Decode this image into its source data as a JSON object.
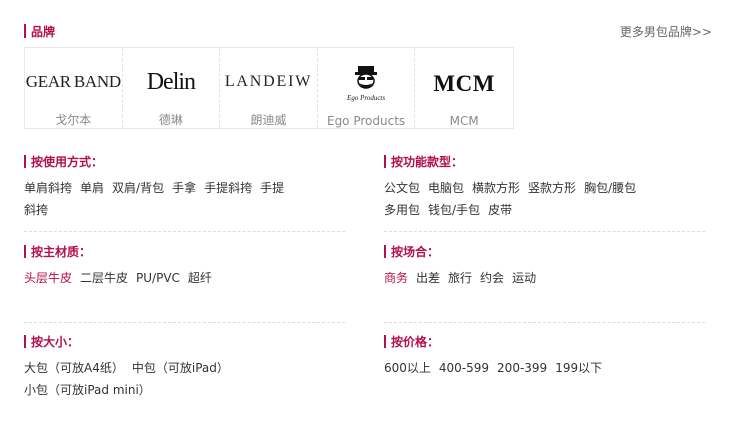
{
  "brands": {
    "title": "品牌",
    "more_link": "更多男包品牌>>",
    "items": [
      {
        "name": "戈尔本",
        "logo_text_1": "GEAR",
        "logo_text_2": "BAND",
        "icon": "gear-band-logo"
      },
      {
        "name": "德琳",
        "logo_text": "Delin",
        "icon": "delin-logo"
      },
      {
        "name": "朗迪威",
        "logo_text": "LANDEIW",
        "icon": "landeiw-logo"
      },
      {
        "name": "Ego Products",
        "logo_text": "Ego Products",
        "icon": "ego-products-logo"
      },
      {
        "name": "MCM",
        "logo_text": "MCM",
        "icon": "mcm-logo"
      }
    ]
  },
  "filters": {
    "usage": {
      "title": "按使用方式：",
      "options": [
        "单肩斜挎",
        "单肩",
        "双肩/背包",
        "手拿",
        "手提斜挎",
        "手提",
        "斜挎"
      ]
    },
    "function": {
      "title": "按功能款型：",
      "options": [
        "公文包",
        "电脑包",
        "横款方形",
        "竖款方形",
        "胸包/腰包",
        "多用包",
        "钱包/手包",
        "皮带"
      ]
    },
    "material": {
      "title": "按主材质：",
      "options": [
        "头层牛皮",
        "二层牛皮",
        "PU/PVC",
        "超纤"
      ],
      "selected": 0
    },
    "occasion": {
      "title": "按场合：",
      "options": [
        "商务",
        "出差",
        "旅行",
        "约会",
        "运动"
      ],
      "selected": 0
    },
    "size": {
      "title": "按大小：",
      "options": [
        "大包（可放A4纸）",
        "中包（可放iPad）",
        "小包（可放iPad mini）"
      ]
    },
    "price": {
      "title": "按价格：",
      "options": [
        "600以上",
        "400-599",
        "200-399",
        "199以下"
      ]
    }
  },
  "colors": {
    "accent": "#b30f4d",
    "text": "#333333",
    "muted": "#8a8a8a"
  }
}
